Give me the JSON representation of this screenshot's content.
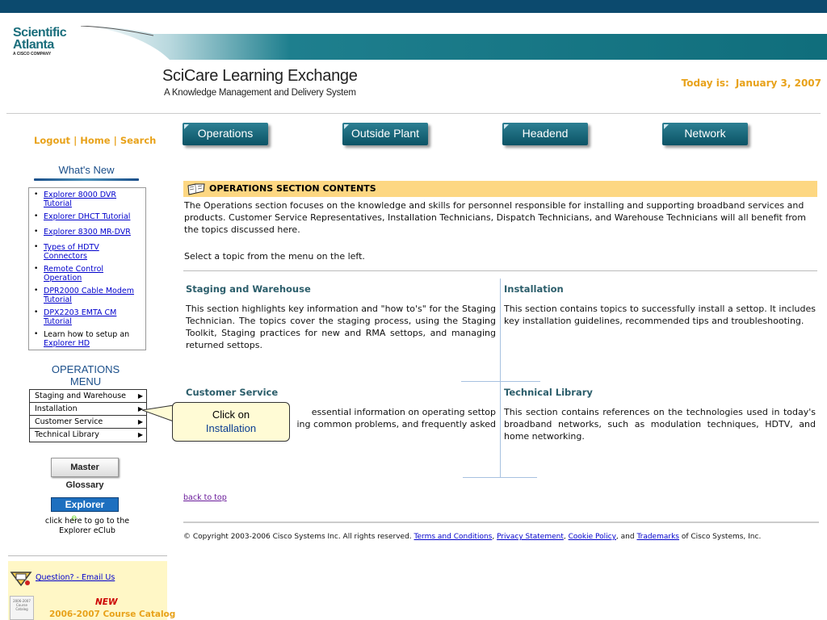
{
  "header": {
    "logo": {
      "line1": "Scientific",
      "line2": "Atlanta",
      "line3": "A CISCO COMPANY"
    },
    "title": "SciCare Learning Exchange",
    "subtitle": "A Knowledge Management and Delivery System",
    "today_label": "Today is:",
    "today_date": "January 3, 2007"
  },
  "toplinks": {
    "logout": "Logout",
    "sep1": "|",
    "home": "Home",
    "sep2": "|",
    "search": "Search"
  },
  "whats_new": {
    "heading": "What's New",
    "items": [
      {
        "text": "Explorer 8000 DVR Tutorial",
        "link": true
      },
      {
        "text": "Explorer DHCT Tutorial",
        "link": true
      },
      {
        "text": "Explorer 8300 MR-DVR",
        "link": true
      },
      {
        "text": "Types of HDTV Connectors",
        "link": true
      },
      {
        "text": "Remote Control Operation",
        "link": true
      },
      {
        "text": "DPR2000 Cable Modem Tutorial",
        "link": true
      },
      {
        "text": "DPX2203 EMTA CM Tutorial",
        "link": true
      },
      {
        "text": "Learn how to setup an",
        "link_text": "Explorer HD"
      }
    ]
  },
  "ops_menu": {
    "heading": "OPERATIONS MENU",
    "items": [
      "Staging and Warehouse",
      "Installation",
      "Customer Service",
      "Technical Library"
    ]
  },
  "master_glossary": "Master Glossary",
  "eclub": {
    "prefix": "Explorer ",
    "e": "e",
    "suffix": "Club",
    "caption_line1": "click here to go to the",
    "caption_line2": "Explorer eClub"
  },
  "question_link": "Question? - Email Us",
  "catalog": {
    "thumb": "2006-2007 Course Catalog",
    "new": "NEW",
    "title": "2006-2007 Course Catalog"
  },
  "nav": [
    "Operations",
    "Outside Plant",
    "Headend",
    "Network"
  ],
  "section": {
    "title": "OPERATIONS SECTION CONTENTS",
    "intro": "The Operations section focuses on the knowledge and skills for personnel responsible for installing and supporting broadband services and products. Customer Service Representatives, Installation Technicians, Dispatch Technicians, and Warehouse Technicians will all benefit from the topics discussed here.",
    "select_topic": "Select a topic from the menu on the left."
  },
  "cells": {
    "staging": {
      "title": "Staging and Warehouse",
      "body": "This section highlights key information and \"how to's\" for the Staging Technician. The topics cover the staging process, using the Staging Toolkit, Staging practices for new and RMA settops, and managing returned settops."
    },
    "installation": {
      "title": "Installation",
      "body": "This section contains topics to successfully install a settop. It includes key installation guidelines, recommended tips and troubleshooting."
    },
    "customer_service": {
      "title": "Customer Service",
      "body_line1": "essential information on operating settop",
      "body_line2": "ing common problems, and frequently asked"
    },
    "technical_library": {
      "title": "Technical Library",
      "body": "This section contains references on the technologies used in today's broadband networks, such as modulation techniques, HDTV, and home networking."
    }
  },
  "callout": {
    "line1": "Click on",
    "line2": "Installation"
  },
  "back_to_top": "back to top",
  "footer": {
    "prefix": "© Copyright 2003-2006 Cisco Systems Inc. All rights reserved.",
    "terms": "Terms and Conditions",
    "privacy": "Privacy Statement",
    "cookie": "Cookie Policy",
    "and_word": ", and",
    "trademarks": "Trademarks",
    "suffix": "of Cisco Systems, Inc."
  }
}
